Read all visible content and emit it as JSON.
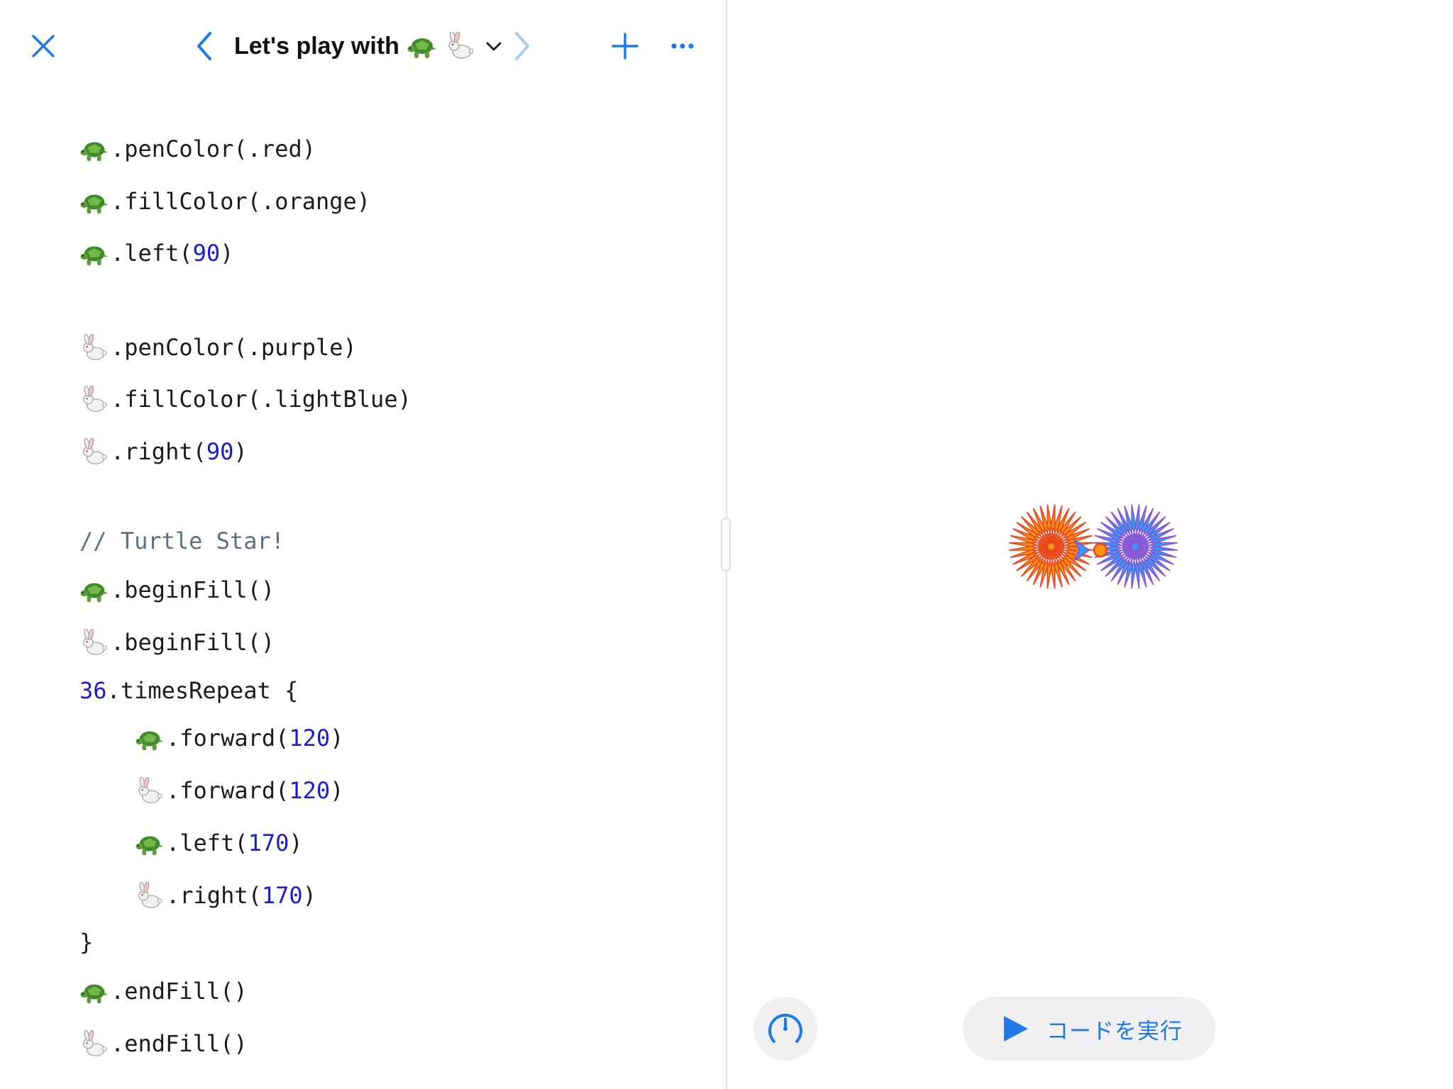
{
  "toolbar": {
    "title": "Let's play with",
    "close_icon": "close-icon",
    "back_icon": "chevron-left-icon",
    "forward_icon": "chevron-right-icon",
    "dropdown_icon": "chevron-down-icon",
    "add_icon": "plus-icon",
    "more_icon": "ellipsis-icon"
  },
  "code": {
    "lines": [
      {
        "t": "e1",
        "s": ".penColor(.red)"
      },
      {
        "t": "e1",
        "s": ".fillColor(.orange)"
      },
      {
        "t": "e1",
        "s": ".left(",
        "n": "90",
        "e": ")"
      },
      {
        "t": "e2",
        "s": ".penColor(.purple)"
      },
      {
        "t": "e2",
        "s": ".fillColor(.lightBlue)"
      },
      {
        "t": "e2",
        "s": ".right(",
        "n": "90",
        "e": ")"
      },
      {
        "t": "c",
        "s": "// Turtle Star!"
      },
      {
        "t": "e1",
        "s": ".beginFill()"
      },
      {
        "t": "e2",
        "s": ".beginFill()"
      },
      {
        "t": "n",
        "n": "36",
        "e": ".timesRepeat {"
      },
      {
        "t": "e1",
        "s": ".forward(",
        "n": "120",
        "e": ")"
      },
      {
        "t": "e2",
        "s": ".forward(",
        "n": "120",
        "e": ")"
      },
      {
        "t": "e1",
        "s": ".left(",
        "n": "170",
        "e": ")"
      },
      {
        "t": "e2",
        "s": ".right(",
        "n": "170",
        "e": ")"
      },
      {
        "t": "p",
        "s": "}"
      },
      {
        "t": "e1",
        "s": ".endFill()"
      },
      {
        "t": "e2",
        "s": ".endFill()"
      }
    ]
  },
  "run": {
    "label": "コードを実行",
    "play_icon": "play-icon",
    "speed_icon": "speedometer-icon"
  },
  "colors": {
    "accent": "#1e7ae6",
    "turtle_pen": "#e8461f",
    "turtle_fill": "#ff9410",
    "rabbit_pen": "#8a55d6",
    "rabbit_fill": "#2e9df2",
    "number": "#1d1bd1",
    "comment": "#5d6f86"
  }
}
